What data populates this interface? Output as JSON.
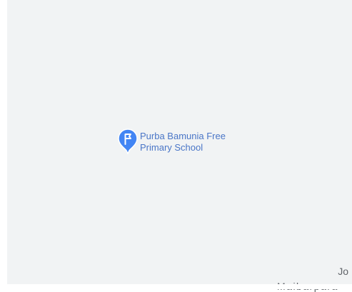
{
  "map": {
    "background_color": "#f1f3f4",
    "poi": {
      "icon": "school-pin-icon",
      "color": "#4285f4",
      "label_line1": "Purba Bamunia Free",
      "label_line2": "Primary School"
    },
    "edge_labels": {
      "right_partial": "Jo",
      "bottom_partial": "Maibarpara"
    }
  }
}
